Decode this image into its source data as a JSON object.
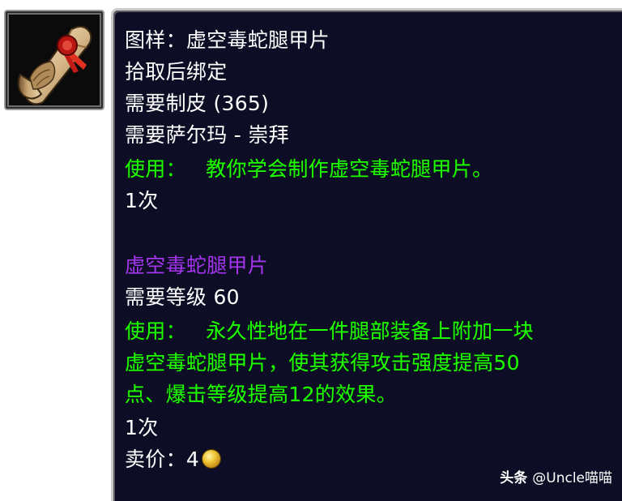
{
  "item_icon": {
    "icon": "pattern-scroll-icon"
  },
  "tooltip": {
    "title": "图样：虚空毒蛇腿甲片",
    "bind": "拾取后绑定",
    "req_skill": "需要制皮 (365)",
    "req_rep": "需要萨尔玛 - 崇拜",
    "use_label": "使用：",
    "use_text": "教你学会制作虚空毒蛇腿甲片。",
    "charges": "1次",
    "crafted_name": "虚空毒蛇腿甲片",
    "crafted_req_level": "需要等级 60",
    "crafted_use_label": "使用：",
    "crafted_use_line1": "永久性地在一件腿部装备上附加一块",
    "crafted_use_line2": "虚空毒蛇腿甲片，使其获得攻击强度提高50",
    "crafted_use_line3": "点、爆击等级提高12的效果。",
    "crafted_charges": "1次",
    "sell_label": "卖价：",
    "sell_value": "4",
    "sell_coin_icon": "gold-coin-icon"
  },
  "watermark": {
    "brand": "头条",
    "handle": "@Uncle喵喵"
  },
  "colors": {
    "panel_bg": "#0d0e25",
    "text_white": "#ffffff",
    "text_green": "#1eff00",
    "text_purple": "#a335ee",
    "border": "#c9c9cc"
  }
}
